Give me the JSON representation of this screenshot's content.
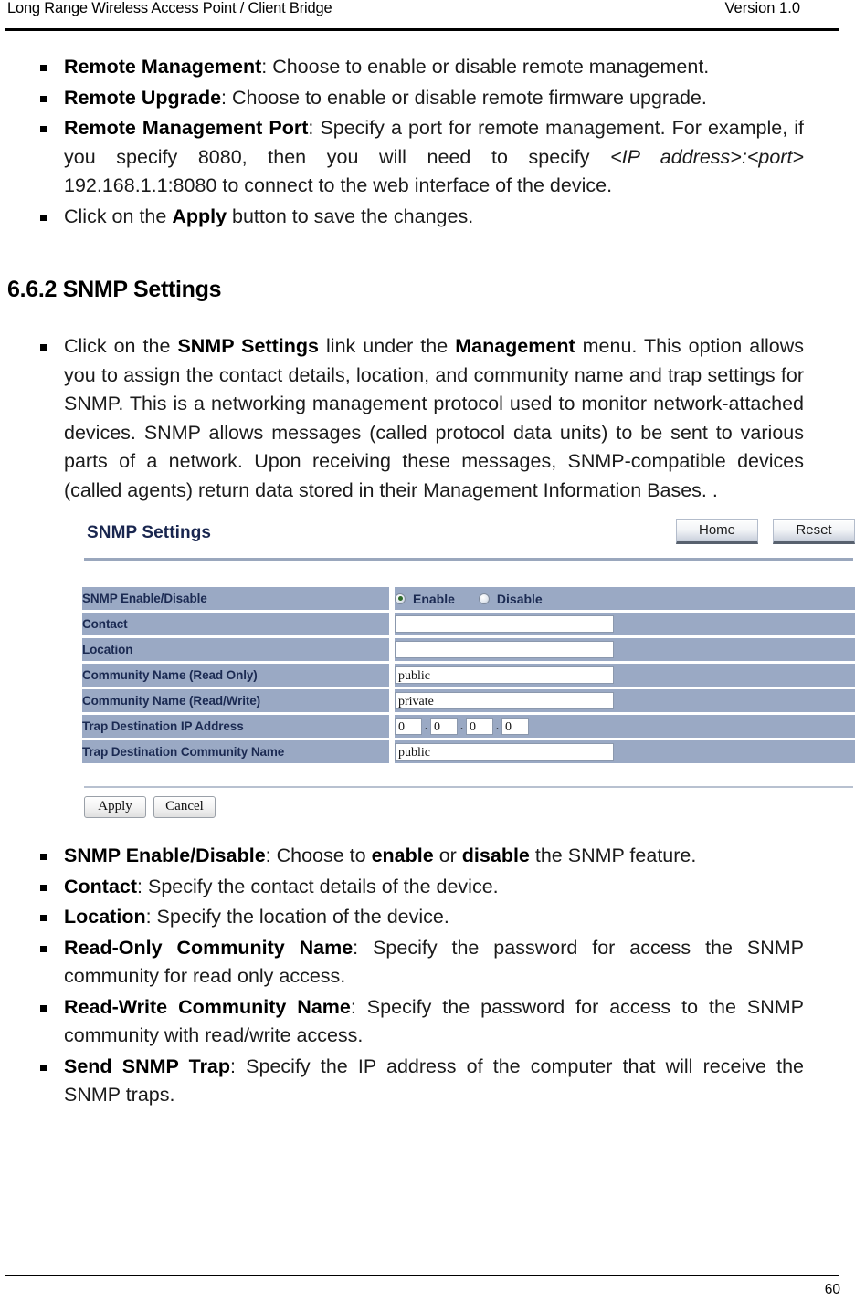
{
  "header": {
    "title": "Long Range Wireless Access Point / Client Bridge",
    "version": "Version 1.0"
  },
  "bullets_top": [
    {
      "segments": [
        {
          "text": "Remote Management",
          "style": "bold"
        },
        {
          "text": ": Choose to enable or disable remote management.",
          "style": "normal"
        }
      ]
    },
    {
      "segments": [
        {
          "text": "Remote Upgrade",
          "style": "bold"
        },
        {
          "text": ": Choose to enable or disable remote firmware upgrade.",
          "style": "normal"
        }
      ]
    },
    {
      "segments": [
        {
          "text": "Remote Management Port",
          "style": "bold"
        },
        {
          "text": ": Specify a port for remote management. For example, if you specify 8080, then you will need to specify ",
          "style": "normal"
        },
        {
          "text": "<IP address>:<port>",
          "style": "italic"
        },
        {
          "text": " 192.168.1.1:8080 to connect to the web interface of the device.",
          "style": "normal"
        }
      ]
    },
    {
      "segments": [
        {
          "text": "Click on the ",
          "style": "normal"
        },
        {
          "text": "Apply",
          "style": "bold"
        },
        {
          "text": " button to save the changes.",
          "style": "normal"
        }
      ]
    }
  ],
  "section": {
    "number": "6.6.2",
    "title": "SNMP Settings",
    "heading_full": "6.6.2 SNMP Settings"
  },
  "bullets_intro": [
    {
      "segments": [
        {
          "text": "Click on the ",
          "style": "normal"
        },
        {
          "text": "SNMP Settings",
          "style": "bold"
        },
        {
          "text": " link under the ",
          "style": "normal"
        },
        {
          "text": "Management",
          "style": "bold"
        },
        {
          "text": " menu. This option allows you to assign the contact details, location, and community name and trap settings for SNMP. This is a networking management protocol used to monitor network-attached devices. SNMP allows messages (called protocol data units) to be sent to various parts of a network. Upon receiving these messages, SNMP-compatible devices (called agents) return data stored in their Management Information Bases. .",
          "style": "normal"
        }
      ]
    }
  ],
  "device_ui": {
    "panel_title": "SNMP Settings",
    "home_button": "Home",
    "reset_button": "Reset",
    "rows": [
      {
        "label": "SNMP Enable/Disable",
        "type": "radio",
        "options": [
          {
            "label": "Enable",
            "checked": true
          },
          {
            "label": "Disable",
            "checked": false
          }
        ]
      },
      {
        "label": "Contact",
        "type": "text",
        "value": ""
      },
      {
        "label": "Location",
        "type": "text",
        "value": ""
      },
      {
        "label": "Community Name (Read Only)",
        "type": "text",
        "value": "public"
      },
      {
        "label": "Community Name (Read/Write)",
        "type": "text",
        "value": "private"
      },
      {
        "label": "Trap Destination IP Address",
        "type": "ip",
        "octets": [
          "0",
          "0",
          "0",
          "0"
        ],
        "separator": "."
      },
      {
        "label": "Trap Destination Community Name",
        "type": "text",
        "value": "public"
      }
    ],
    "apply_button": "Apply",
    "cancel_button": "Cancel"
  },
  "bullets_bottom": [
    {
      "segments": [
        {
          "text": "SNMP Enable/Disable",
          "style": "bold"
        },
        {
          "text": ": Choose to ",
          "style": "normal"
        },
        {
          "text": "enable",
          "style": "bold"
        },
        {
          "text": " or ",
          "style": "normal"
        },
        {
          "text": "disable",
          "style": "bold"
        },
        {
          "text": " the SNMP feature.",
          "style": "normal"
        }
      ]
    },
    {
      "segments": [
        {
          "text": "Contact",
          "style": "bold"
        },
        {
          "text": ": Specify the contact details of the device.",
          "style": "normal"
        }
      ]
    },
    {
      "segments": [
        {
          "text": "Location",
          "style": "bold"
        },
        {
          "text": ": Specify the location of the device.",
          "style": "normal"
        }
      ]
    },
    {
      "segments": [
        {
          "text": "Read-Only Community Name",
          "style": "bold"
        },
        {
          "text": ": Specify the password for access the SNMP community for read only access.",
          "style": "normal"
        }
      ]
    },
    {
      "segments": [
        {
          "text": "Read-Write Community Name",
          "style": "bold"
        },
        {
          "text": ": Specify the password for access to the SNMP community with read/write access.",
          "style": "normal"
        }
      ]
    },
    {
      "segments": [
        {
          "text": "Send SNMP Trap",
          "style": "bold"
        },
        {
          "text": ": Specify the IP address of the computer that will receive the SNMP traps.",
          "style": "normal"
        }
      ]
    }
  ],
  "footer": {
    "page_number": "60"
  },
  "colors": {
    "row_background": "#9aa9c4",
    "label_text": "#1b2a52",
    "panel_title": "#19264f",
    "rule": "#9aa7bd",
    "radio_checked": "#2f6b2a"
  }
}
